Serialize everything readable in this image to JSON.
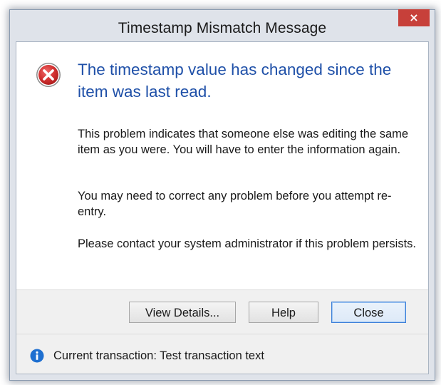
{
  "window": {
    "title": "Timestamp Mismatch Message",
    "close_glyph": "×"
  },
  "icons": {
    "status": "error-icon",
    "footer": "info-icon"
  },
  "message": {
    "main_instruction": "The timestamp value has changed since the item was last read.",
    "paragraphs": [
      "This problem indicates that someone else was editing the same item as you were. You will have to enter the information again.",
      "You may need to correct any problem before you attempt re-entry.",
      "Please contact your system administrator if this problem persists."
    ]
  },
  "buttons": {
    "view_details": "View Details...",
    "help": "Help",
    "close": "Close"
  },
  "footer": {
    "text": "Current transaction: Test transaction text"
  },
  "colors": {
    "accent_text": "#1f50a8",
    "close_button": "#c7403a",
    "error_icon": "#c62a2a",
    "info_icon": "#1e6fd0",
    "default_button_border": "#3c7fd8"
  }
}
